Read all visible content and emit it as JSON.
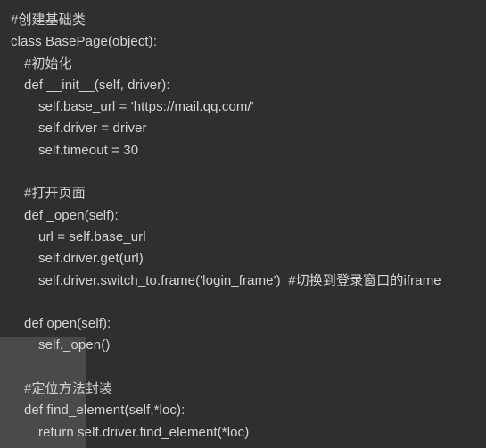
{
  "editor": {
    "name": "code-snippet-viewer",
    "language": "Python",
    "background_color": "#2f2f2f",
    "text_color": "#d5d5d5",
    "selection_color": "#4a4a4a",
    "lines": [
      {
        "text": "#创建基础类",
        "indent": 0
      },
      {
        "text": "class BasePage(object):",
        "indent": 0
      },
      {
        "text": "#初始化",
        "indent": 1
      },
      {
        "text": "def __init__(self, driver):",
        "indent": 1
      },
      {
        "text": "self.base_url = 'https://mail.qq.com/'",
        "indent": 2
      },
      {
        "text": "self.driver = driver",
        "indent": 2
      },
      {
        "text": "self.timeout = 30",
        "indent": 2
      },
      {
        "text": "",
        "indent": 0
      },
      {
        "text": "#打开页面",
        "indent": 1
      },
      {
        "text": "def _open(self):",
        "indent": 1
      },
      {
        "text": "url = self.base_url",
        "indent": 2
      },
      {
        "text": "self.driver.get(url)",
        "indent": 2
      },
      {
        "text": "self.driver.switch_to.frame('login_frame')  #切换到登录窗口的iframe",
        "indent": 2
      },
      {
        "text": "",
        "indent": 0
      },
      {
        "text": "def open(self):",
        "indent": 1
      },
      {
        "text": "self._open()",
        "indent": 2
      },
      {
        "text": "",
        "indent": 0
      },
      {
        "text": "#定位方法封装",
        "indent": 1
      },
      {
        "text": "def find_element(self,*loc):",
        "indent": 1
      },
      {
        "text": "return self.driver.find_element(*loc)",
        "indent": 2
      }
    ]
  }
}
